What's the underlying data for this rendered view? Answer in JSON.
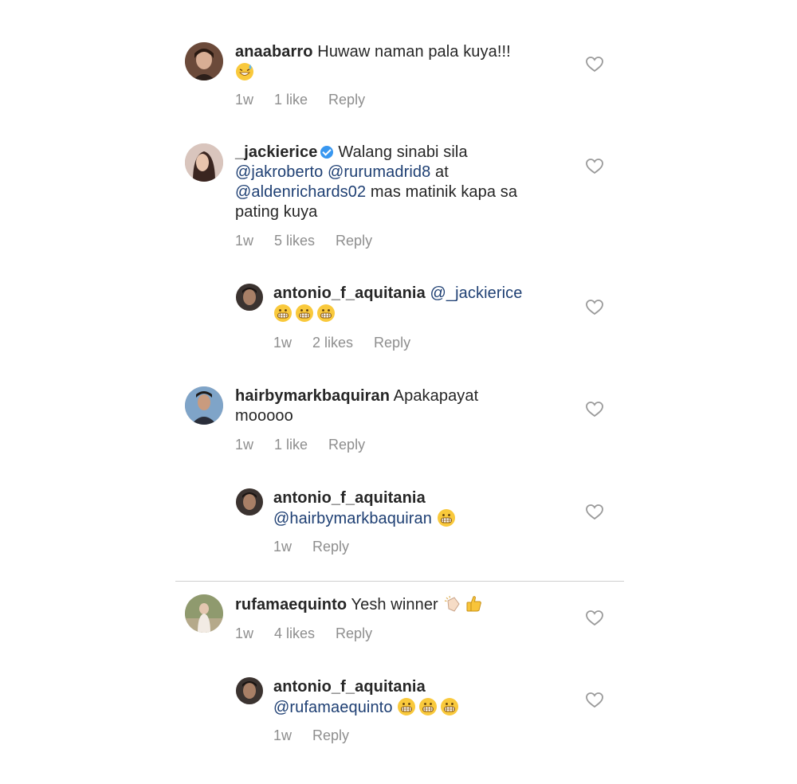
{
  "comments": [
    {
      "username": "anaabarro",
      "text": "Huwaw naman pala kuya!!!",
      "time": "1w",
      "likes": "1 like",
      "reply": "Reply"
    },
    {
      "username": "_jackierice",
      "text_1": "Walang sinabi sila",
      "mention_1": "@jakroberto",
      "mention_2": "@rurumadrid8",
      "text_2": "at",
      "mention_3": "@aldenrichards02",
      "text_3": "mas matinik kapa sa",
      "text_4": "pating kuya",
      "time": "1w",
      "likes": "5 likes",
      "reply": "Reply"
    },
    {
      "username": "antonio_f_aquitania",
      "mention": "@_jackierice",
      "time": "1w",
      "likes": "2 likes",
      "reply": "Reply"
    },
    {
      "username": "hairbymarkbaquiran",
      "text_1": "Apakapayat",
      "text_2": "mooooo",
      "time": "1w",
      "likes": "1 like",
      "reply": "Reply"
    },
    {
      "username": "antonio_f_aquitania",
      "mention": "@hairbymarkbaquiran",
      "time": "1w",
      "reply": "Reply"
    },
    {
      "username": "rufamaequinto",
      "text": "Yesh winner",
      "time": "1w",
      "likes": "4 likes",
      "reply": "Reply"
    },
    {
      "username": "antonio_f_aquitania",
      "mention": "@rufamaequinto",
      "time": "1w",
      "reply": "Reply"
    }
  ],
  "icons": {
    "heart": "heart-outline-icon",
    "grin": "grimacing-face-emoji",
    "sweat": "grinning-sweat-emoji",
    "clap": "clapping-hands-emoji",
    "thumbs": "thumbs-up-emoji",
    "verified": "verified-badge-icon"
  },
  "colors": {
    "text": "#262626",
    "meta": "#8e8e8e",
    "mention": "#1e3f73",
    "verified": "#3897f0"
  }
}
